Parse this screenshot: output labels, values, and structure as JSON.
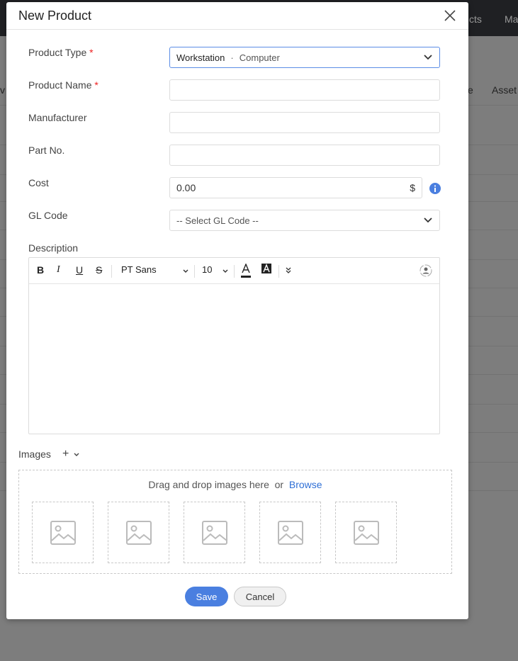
{
  "background": {
    "nav_items": [
      "cts",
      "Ma"
    ],
    "columns": [
      "v",
      "e",
      "Asset"
    ]
  },
  "modal": {
    "title": "New Product",
    "fields": {
      "product_type": {
        "label": "Product Type",
        "required": "*",
        "value_primary": "Workstation",
        "separator": "·",
        "value_secondary": "Computer"
      },
      "product_name": {
        "label": "Product Name",
        "required": "*",
        "value": ""
      },
      "manufacturer": {
        "label": "Manufacturer",
        "value": ""
      },
      "part_no": {
        "label": "Part No.",
        "value": ""
      },
      "cost": {
        "label": "Cost",
        "value": "0.00",
        "currency": "$"
      },
      "gl_code": {
        "label": "GL Code",
        "placeholder": "-- Select GL Code --"
      },
      "description": {
        "label": "Description",
        "font": "PT Sans",
        "size": "10"
      }
    },
    "images": {
      "label": "Images",
      "add": "+",
      "drop_text": "Drag and drop images here",
      "or": "or",
      "browse": "Browse",
      "slots": 5
    },
    "buttons": {
      "save": "Save",
      "cancel": "Cancel"
    },
    "colors": {
      "primary": "#4a7fe0",
      "info": "#4a7fe0",
      "required": "#e22222"
    }
  }
}
